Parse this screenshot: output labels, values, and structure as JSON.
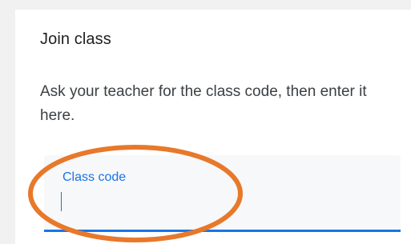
{
  "dialog": {
    "title": "Join class",
    "description": "Ask your teacher for the class code, then enter it here.",
    "class_code_field": {
      "label": "Class code",
      "value": ""
    }
  },
  "colors": {
    "accent": "#1a73e8",
    "highlight_ring": "#e8782a",
    "background": "#f1f1f1"
  }
}
